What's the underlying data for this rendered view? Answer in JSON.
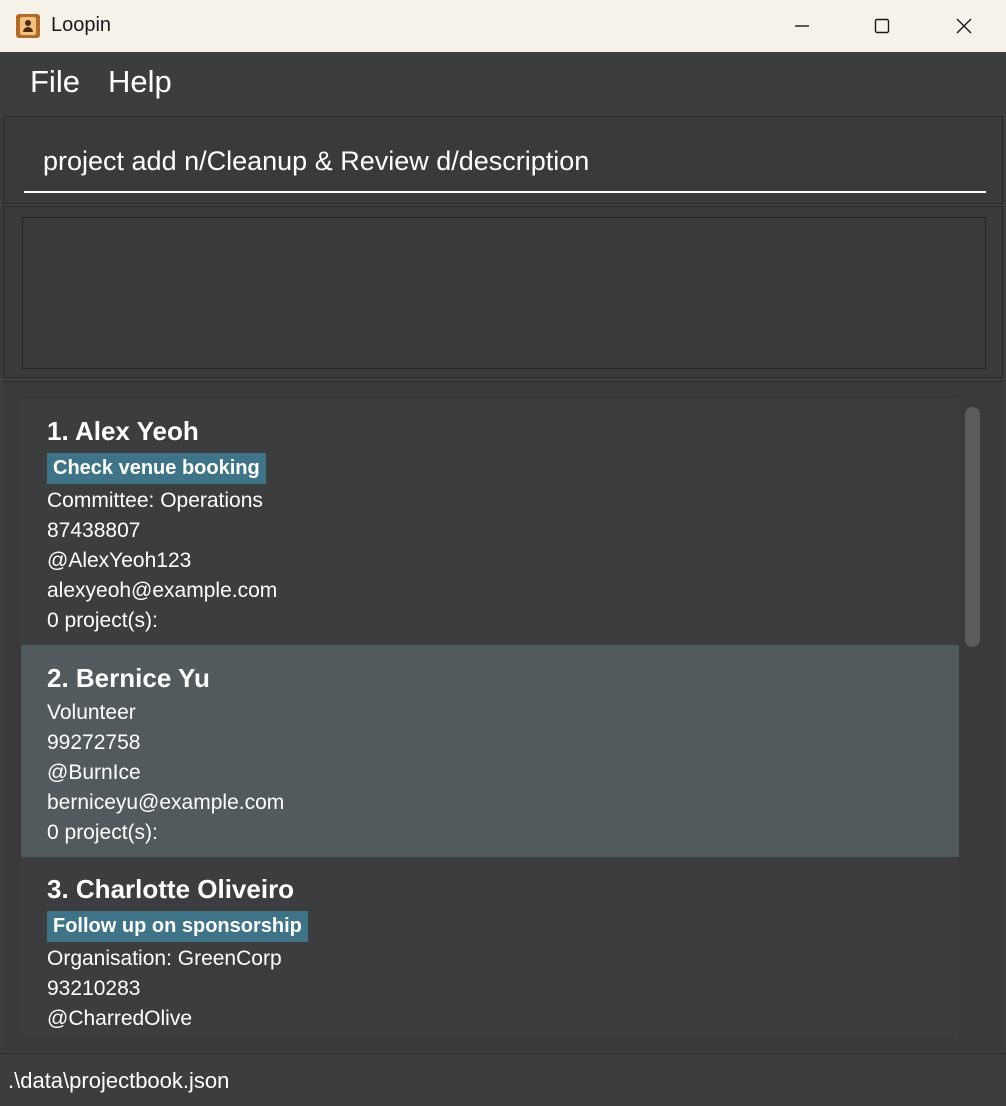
{
  "window": {
    "title": "Loopin"
  },
  "menu": {
    "file": "File",
    "help": "Help"
  },
  "command_box": {
    "value": "project add n/Cleanup & Review d/description"
  },
  "result_display": {
    "text": ""
  },
  "persons": [
    {
      "title": "1. Alex Yeoh",
      "tag": "Check venue booking",
      "role": "Committee: Operations",
      "phone": "87438807",
      "handle": "@AlexYeoh123",
      "email": "alexyeoh@example.com",
      "projects": "0 project(s):",
      "selected": false
    },
    {
      "title": "2. Bernice Yu",
      "role": "Volunteer",
      "phone": "99272758",
      "handle": "@BurnIce",
      "email": "berniceyu@example.com",
      "projects": "0 project(s):",
      "selected": true
    },
    {
      "title": "3. Charlotte Oliveiro",
      "tag": "Follow up on sponsorship",
      "role": "Organisation: GreenCorp",
      "phone": "93210283",
      "handle": "@CharredOlive",
      "selected": false
    }
  ],
  "status_bar": {
    "path": ".\\data\\projectbook.json"
  },
  "colors": {
    "background": "#3c3d3f",
    "selected_card": "#525a5e",
    "tag": "#3f7387",
    "titlebar": "#f6f2ea"
  },
  "icons": {
    "app": "contact-book-icon",
    "minimize": "minimize-icon",
    "maximize": "maximize-icon",
    "close": "close-icon"
  }
}
